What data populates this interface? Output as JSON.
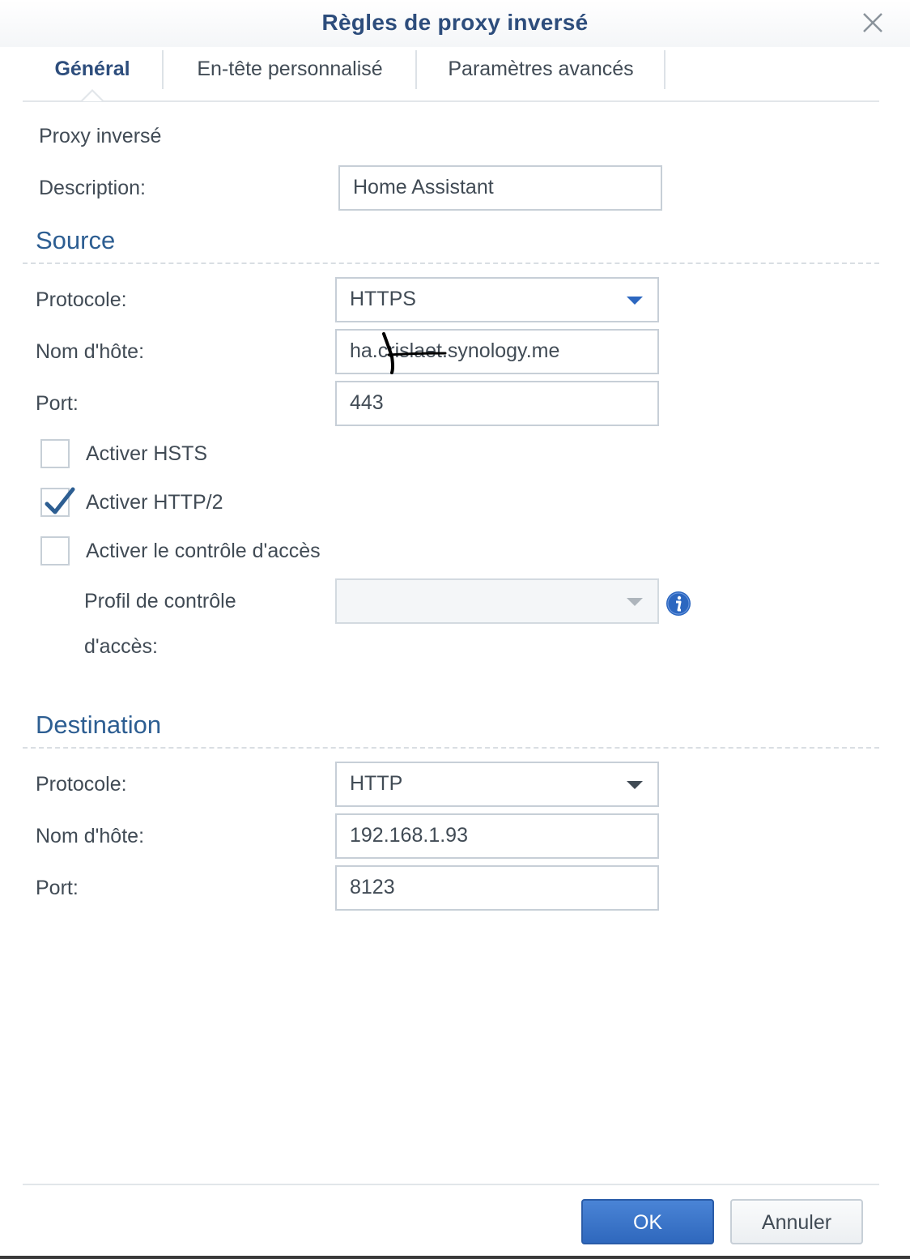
{
  "dialog": {
    "title": "Règles de proxy inversé",
    "close_icon": "close-icon"
  },
  "tabs": [
    {
      "label": "Général",
      "active": true
    },
    {
      "label": "En-tête personnalisé",
      "active": false
    },
    {
      "label": "Paramètres avancés",
      "active": false
    }
  ],
  "general": {
    "heading": "Proxy inversé",
    "description_label": "Description:",
    "description_value": "Home Assistant"
  },
  "source": {
    "heading": "Source",
    "protocol_label": "Protocole:",
    "protocol_value": "HTTPS",
    "hostname_label": "Nom d'hôte:",
    "hostname_value": "ha.crislaet.synology.me",
    "port_label": "Port:",
    "port_value": "443",
    "hsts_label": "Activer HSTS",
    "hsts_checked": false,
    "http2_label": "Activer HTTP/2",
    "http2_checked": true,
    "access_control_label": "Activer le contrôle d'accès",
    "access_control_checked": false,
    "access_profile_label_line1": "Profil de contrôle",
    "access_profile_label_line2": "d'accès:",
    "access_profile_value": ""
  },
  "destination": {
    "heading": "Destination",
    "protocol_label": "Protocole:",
    "protocol_value": "HTTP",
    "hostname_label": "Nom d'hôte:",
    "hostname_value": "192.168.1.93",
    "port_label": "Port:",
    "port_value": "8123"
  },
  "footer": {
    "ok_label": "OK",
    "cancel_label": "Annuler"
  },
  "colors": {
    "accent": "#2d4d7c",
    "section": "#2d5e92",
    "primary_button": "#3a74c8"
  }
}
